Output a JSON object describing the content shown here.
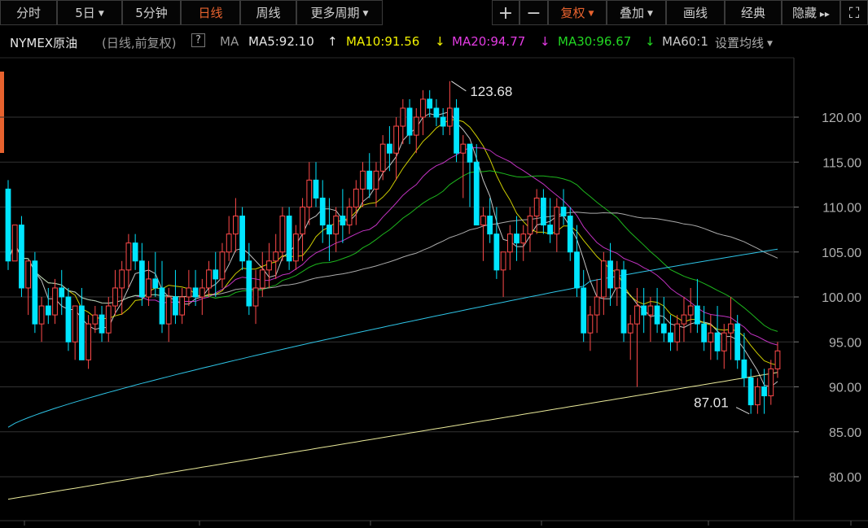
{
  "toolbar": {
    "left": [
      {
        "label": "分时",
        "active": false
      },
      {
        "label": "5日",
        "active": false,
        "caret": true
      },
      {
        "label": "5分钟",
        "active": false
      },
      {
        "label": "日线",
        "active": true
      },
      {
        "label": "周线",
        "active": false
      },
      {
        "label": "更多周期",
        "active": false,
        "caret": true
      }
    ],
    "right": [
      {
        "label": "+",
        "active": false
      },
      {
        "label": "−",
        "active": false
      },
      {
        "label": "复权",
        "active": true,
        "caret": true
      },
      {
        "label": "叠加",
        "active": false,
        "caret": true
      },
      {
        "label": "画线",
        "active": false
      },
      {
        "label": "经典",
        "active": false
      },
      {
        "label": "隐藏",
        "active": false,
        "icon": "double-chevron-right-icon"
      },
      {
        "label": "",
        "active": false,
        "icon": "fullscreen-icon"
      }
    ]
  },
  "legend": {
    "title": "NYMEX原油",
    "subtitle": "(日线,前复权)",
    "help": "?",
    "ma_label": "MA",
    "ma5": "MA5:92.10",
    "ma10": "MA10:91.56",
    "ma20": "MA20:94.77",
    "ma30": "MA30:96.67",
    "ma60": "MA60:1",
    "settings": "设置均线",
    "colors": {
      "ma5": "#e6e6e6",
      "ma10": "#f2f200",
      "ma20": "#e23be2",
      "ma30": "#22d622",
      "ma60": "#c8c8c8"
    }
  },
  "chart_data": {
    "type": "candlestick",
    "y_ticks": [
      "120.00",
      "115.00",
      "110.00",
      "105.00",
      "100.00",
      "95.00",
      "90.00",
      "85.00",
      "80.00"
    ],
    "ylim": [
      77,
      126
    ],
    "annotations": {
      "high": "123.68",
      "low": "87.01"
    },
    "candles": [
      [
        112,
        113,
        103,
        104
      ],
      [
        104,
        108,
        104,
        108
      ],
      [
        108,
        109,
        100,
        101
      ],
      [
        101,
        104,
        98,
        104
      ],
      [
        104,
        105,
        96,
        97
      ],
      [
        97,
        100,
        95,
        99
      ],
      [
        99,
        101,
        97,
        98
      ],
      [
        98,
        102,
        97,
        101
      ],
      [
        101,
        103,
        98,
        100
      ],
      [
        100,
        101,
        94,
        95
      ],
      [
        95,
        99,
        93,
        99
      ],
      [
        99,
        101,
        93,
        93
      ],
      [
        93,
        98,
        92,
        97
      ],
      [
        97,
        99,
        96,
        98
      ],
      [
        98,
        99,
        95,
        96
      ],
      [
        96,
        100,
        95,
        99
      ],
      [
        99,
        103,
        98,
        101
      ],
      [
        101,
        104,
        98,
        103
      ],
      [
        103,
        107,
        101,
        106
      ],
      [
        106,
        107,
        103,
        104
      ],
      [
        104,
        106,
        99,
        100
      ],
      [
        100,
        104,
        99,
        102
      ],
      [
        102,
        105,
        100,
        101
      ],
      [
        101,
        104,
        96,
        97
      ],
      [
        97,
        101,
        95,
        100
      ],
      [
        100,
        103,
        97,
        98
      ],
      [
        98,
        101,
        97,
        100
      ],
      [
        100,
        103,
        99,
        101
      ],
      [
        101,
        103,
        99,
        100
      ],
      [
        100,
        102,
        98,
        101
      ],
      [
        101,
        104,
        100,
        103
      ],
      [
        103,
        105,
        100,
        102
      ],
      [
        102,
        106,
        101,
        105
      ],
      [
        105,
        109,
        104,
        107
      ],
      [
        107,
        111,
        105,
        109
      ],
      [
        109,
        110,
        103,
        104
      ],
      [
        104,
        106,
        98,
        99
      ],
      [
        99,
        103,
        97,
        101
      ],
      [
        101,
        105,
        100,
        103
      ],
      [
        103,
        106,
        101,
        104
      ],
      [
        104,
        107,
        102,
        105
      ],
      [
        105,
        110,
        104,
        109
      ],
      [
        109,
        110,
        103,
        104
      ],
      [
        104,
        108,
        103,
        107
      ],
      [
        107,
        111,
        104,
        110
      ],
      [
        110,
        115,
        108,
        113
      ],
      [
        113,
        115,
        110,
        111
      ],
      [
        111,
        113,
        106,
        108
      ],
      [
        108,
        111,
        104,
        107
      ],
      [
        107,
        110,
        105,
        109
      ],
      [
        109,
        112,
        106,
        108
      ],
      [
        108,
        111,
        107,
        110
      ],
      [
        110,
        113,
        108,
        112
      ],
      [
        112,
        115,
        110,
        114
      ],
      [
        114,
        116,
        111,
        112
      ],
      [
        112,
        115,
        110,
        114
      ],
      [
        114,
        118,
        113,
        117
      ],
      [
        117,
        119,
        114,
        116
      ],
      [
        116,
        120,
        113,
        119
      ],
      [
        119,
        122,
        117,
        121
      ],
      [
        121,
        122,
        117,
        118
      ],
      [
        118,
        121,
        116,
        120
      ],
      [
        120,
        123,
        118,
        122
      ],
      [
        122,
        123,
        120,
        121
      ],
      [
        121,
        122,
        119,
        120
      ],
      [
        120,
        121,
        118,
        119
      ],
      [
        119,
        124,
        118,
        121
      ],
      [
        121,
        122,
        115,
        116
      ],
      [
        116,
        118,
        111,
        117
      ],
      [
        117,
        117,
        110,
        115
      ],
      [
        115,
        117,
        108,
        108
      ],
      [
        108,
        110,
        104,
        109
      ],
      [
        109,
        111,
        106,
        107
      ],
      [
        107,
        110,
        102,
        103
      ],
      [
        103,
        105,
        100,
        105
      ],
      [
        105,
        108,
        103,
        107
      ],
      [
        107,
        109,
        104,
        106
      ],
      [
        106,
        108,
        104,
        107
      ],
      [
        107,
        110,
        105,
        109
      ],
      [
        109,
        112,
        107,
        111
      ],
      [
        111,
        112,
        107,
        108
      ],
      [
        108,
        111,
        106,
        107
      ],
      [
        107,
        111,
        105,
        110
      ],
      [
        110,
        112,
        108,
        109
      ],
      [
        109,
        110,
        104,
        105
      ],
      [
        105,
        108,
        100,
        101
      ],
      [
        101,
        103,
        95,
        96
      ],
      [
        96,
        99,
        94,
        98
      ],
      [
        98,
        102,
        96,
        100
      ],
      [
        100,
        105,
        98,
        104
      ],
      [
        104,
        106,
        99,
        101
      ],
      [
        101,
        104,
        99,
        103
      ],
      [
        103,
        104,
        95,
        96
      ],
      [
        96,
        98,
        93,
        97
      ],
      [
        97,
        101,
        90,
        99
      ],
      [
        99,
        101,
        96,
        98
      ],
      [
        98,
        100,
        95,
        99
      ],
      [
        99,
        101,
        96,
        97
      ],
      [
        97,
        100,
        95,
        96
      ],
      [
        96,
        98,
        94,
        95
      ],
      [
        95,
        98,
        94,
        97
      ],
      [
        97,
        100,
        95,
        98
      ],
      [
        98,
        101,
        96,
        99
      ],
      [
        99,
        102,
        96,
        97
      ],
      [
        97,
        99,
        94,
        95
      ],
      [
        95,
        98,
        93,
        96
      ],
      [
        96,
        99,
        93,
        94
      ],
      [
        94,
        97,
        92,
        96
      ],
      [
        96,
        100,
        93,
        97
      ],
      [
        97,
        98,
        92,
        93
      ],
      [
        93,
        96,
        90,
        91
      ],
      [
        91,
        92,
        87.0,
        88
      ],
      [
        88,
        91,
        87,
        90
      ],
      [
        90,
        92,
        87,
        89
      ],
      [
        89,
        93,
        88,
        92
      ],
      [
        92,
        95,
        91,
        94
      ]
    ]
  }
}
